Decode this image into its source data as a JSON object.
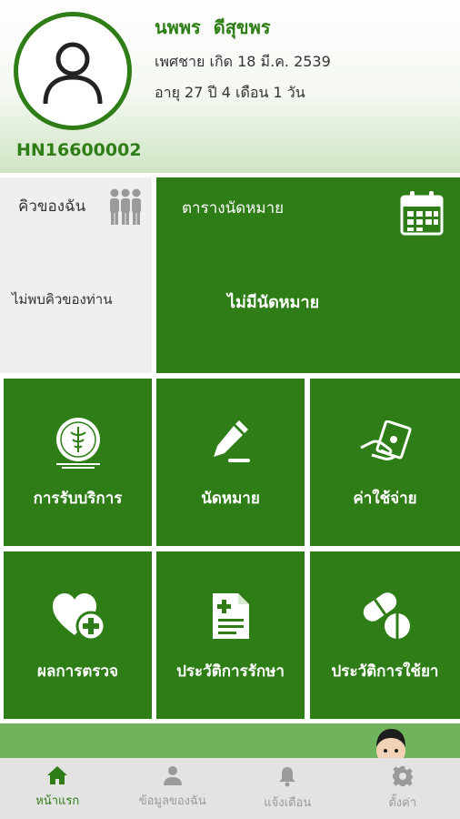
{
  "profile": {
    "name": "นพพร  ดีสุขพร",
    "gender_birth": "เพศชาย เกิด 18 มี.ค. 2539",
    "age": "อายุ 27 ปี 4 เดือน 1 วัน",
    "hn": "HN16600002"
  },
  "queue": {
    "title": "คิวของฉัน",
    "empty_text": "ไม่พบคิวของท่าน",
    "icon": "people-queue-icon"
  },
  "appointments": {
    "title": "ตารางนัดหมาย",
    "empty_text": "ไม่มีนัดหมาย",
    "icon": "calendar-icon"
  },
  "menu": [
    {
      "label": "การรับบริการ",
      "icon": "moph-seal-icon"
    },
    {
      "label": "นัดหมาย",
      "icon": "pen-sign-icon"
    },
    {
      "label": "ค่าใช้จ่าย",
      "icon": "hand-bill-icon"
    },
    {
      "label": "ผลการตรวจ",
      "icon": "heart-plus-icon"
    },
    {
      "label": "ประวัติการรักษา",
      "icon": "medical-record-icon"
    },
    {
      "label": "ประวัติการใช้ยา",
      "icon": "pills-icon"
    }
  ],
  "nav": [
    {
      "label": "หน้าแรก",
      "icon": "home-icon",
      "active": true
    },
    {
      "label": "ข้อมูลของฉัน",
      "icon": "person-icon",
      "active": false
    },
    {
      "label": "แจ้งเตือน",
      "icon": "bell-icon",
      "active": false
    },
    {
      "label": "ตั้งค่า",
      "icon": "gear-icon",
      "active": false
    }
  ],
  "colors": {
    "primary_green": "#2e7d16",
    "banner_green": "#6fb35c",
    "queue_bg": "#efefef",
    "nav_bg": "#e3e3e3",
    "nav_inactive": "#9a9a9a"
  }
}
